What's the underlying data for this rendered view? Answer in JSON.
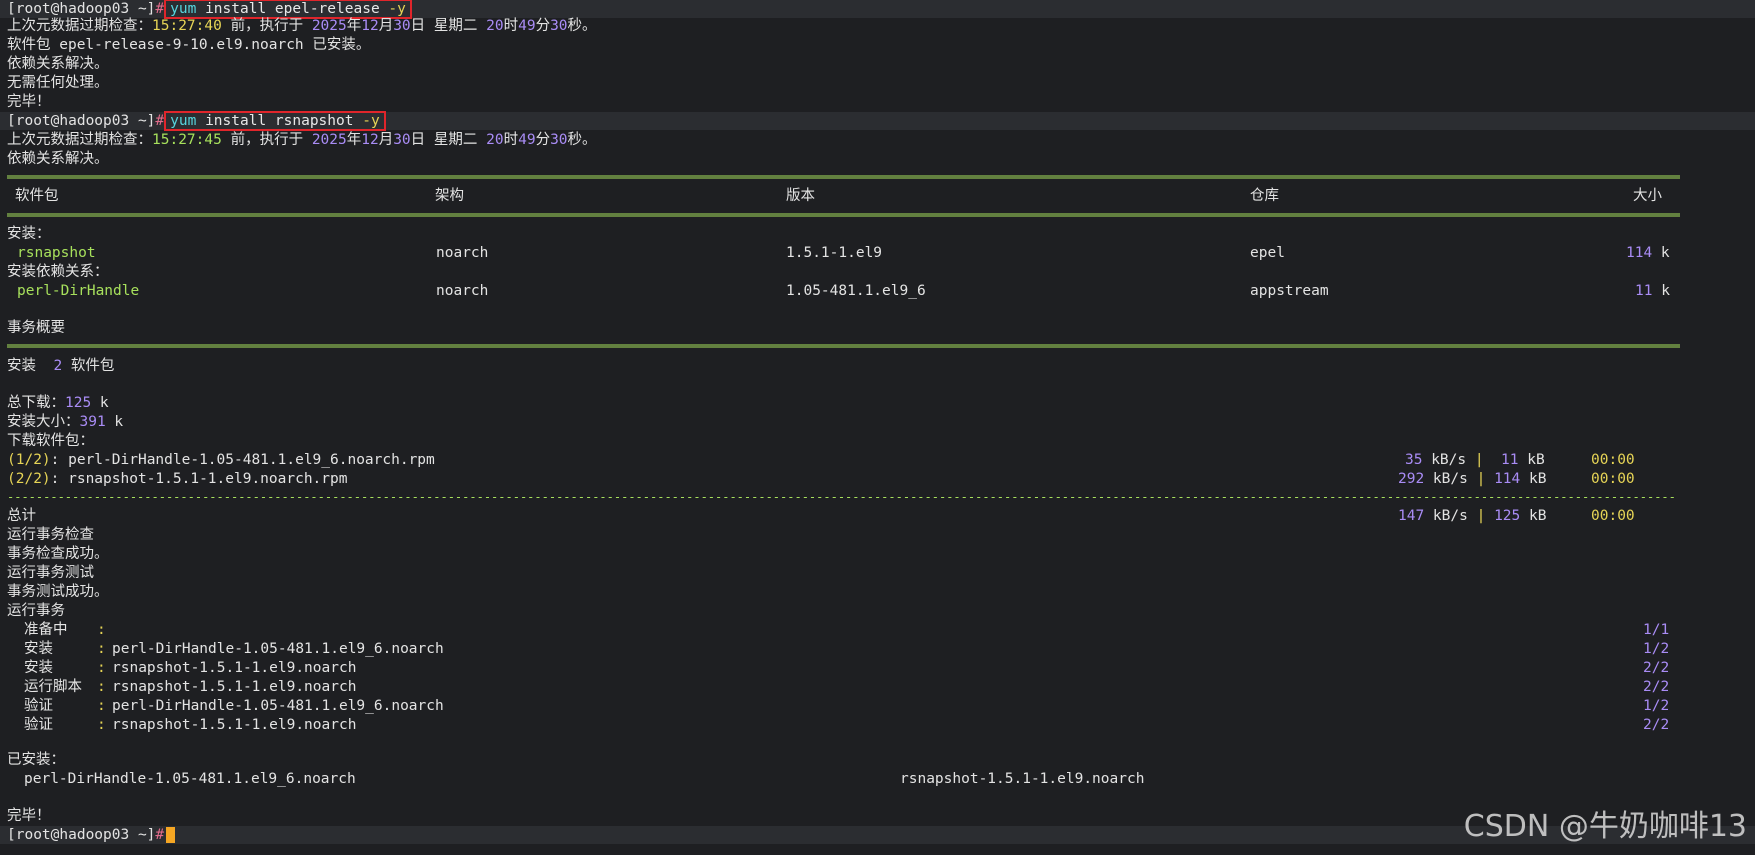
{
  "prompt": "[root@hadoop03 ~]",
  "hash": "#",
  "cmd1": {
    "yum": "yum",
    "rest": " install epel-release ",
    "flag": "-y"
  },
  "meta1": {
    "pre": "上次元数据过期检查：",
    "time": "15:27:40",
    "mid": " 前，执行于 ",
    "year": "2025",
    "nian": "年",
    "month": "12",
    "yue": "月",
    "day": "30",
    "ri": "日 星期二 ",
    "hour": "20",
    "shi": "时",
    "min": "49",
    "fen": "分",
    "sec": "30",
    "miao": "秒。"
  },
  "pkg_installed": "软件包 epel-release-9-10.el9.noarch 已安装。",
  "deps_resolved": "依赖关系解决。",
  "nothing_to_do": "无需任何处理。",
  "done1": "完毕！",
  "cmd2": {
    "yum": "yum",
    "rest": " install rsnapshot ",
    "flag": "-y"
  },
  "meta2": {
    "pre": "上次元数据过期检查：",
    "time": "15:27:45",
    "mid": " 前，执行于 ",
    "year": "2025",
    "nian": "年",
    "month": "12",
    "yue": "月",
    "day": "30",
    "ri": "日 星期二 ",
    "hour": "20",
    "shi": "时",
    "min": "49",
    "fen": "分",
    "sec": "30",
    "miao": "秒。"
  },
  "deps_resolved2": "依赖关系解决。",
  "table": {
    "headers": {
      "pkg": "软件包",
      "arch": "架构",
      "ver": "版本",
      "repo": "仓库",
      "size": "大小"
    },
    "install_label": "安装：",
    "dep_label": "安装依赖关系：",
    "rows": [
      {
        "name": "rsnapshot",
        "arch": "noarch",
        "ver": "1.5.1-1.el9",
        "repo": "epel",
        "size": "114",
        "unit": " k"
      },
      {
        "name": "perl-DirHandle",
        "arch": "noarch",
        "ver": "1.05-481.1.el9_6",
        "repo": "appstream",
        "size": "11",
        "unit": " k"
      }
    ]
  },
  "summary": {
    "title": "事务概要",
    "install_pre": "安装  ",
    "install_count": "2",
    "install_post": " 软件包",
    "total_dl_label": "总下载：",
    "total_dl_val": "125",
    "total_dl_unit": " k",
    "inst_size_label": "安装大小：",
    "inst_size_val": "391",
    "inst_size_unit": " k",
    "downloading": "下载软件包："
  },
  "downloads": [
    {
      "idx": "(1/2)",
      "sep": ":",
      "file": " perl-DirHandle-1.05-481.1.el9_6.noarch.rpm",
      "speed": "35",
      "speed_unit": " kB/s",
      "bar": " | ",
      "size": " 11",
      "size_unit": " kB",
      "time": "00:00"
    },
    {
      "idx": "(2/2)",
      "sep": ":",
      "file": " rsnapshot-1.5.1-1.el9.noarch.rpm",
      "speed": "292",
      "speed_unit": " kB/s",
      "bar": " | ",
      "size": "114",
      "size_unit": " kB",
      "time": "00:00"
    }
  ],
  "total": {
    "label": "总计",
    "speed": "147",
    "speed_unit": " kB/s",
    "bar": " | ",
    "size": "125",
    "size_unit": " kB",
    "time": "00:00"
  },
  "transaction": [
    "运行事务检查",
    "事务检查成功。",
    "运行事务测试",
    "事务测试成功。",
    "运行事务"
  ],
  "steps": [
    {
      "label": "准备中",
      "colon": ":",
      "pkg": "",
      "count": "1/1"
    },
    {
      "label": "安装",
      "colon": ":",
      "pkg": "perl-DirHandle-1.05-481.1.el9_6.noarch",
      "count": "1/2"
    },
    {
      "label": "安装",
      "colon": ":",
      "pkg": "rsnapshot-1.5.1-1.el9.noarch",
      "count": "2/2"
    },
    {
      "label": "运行脚本",
      "colon": ":",
      "pkg": "rsnapshot-1.5.1-1.el9.noarch",
      "count": "2/2"
    },
    {
      "label": "验证",
      "colon": ":",
      "pkg": "perl-DirHandle-1.05-481.1.el9_6.noarch",
      "count": "1/2"
    },
    {
      "label": "验证",
      "colon": ":",
      "pkg": "rsnapshot-1.5.1-1.el9.noarch",
      "count": "2/2"
    }
  ],
  "installed_label": "已安装：",
  "installed": [
    "perl-DirHandle-1.05-481.1.el9_6.noarch",
    "rsnapshot-1.5.1-1.el9.noarch"
  ],
  "done2": "完毕！",
  "watermark": "CSDN @牛奶咖啡13",
  "colors": {
    "background": "#1e1f22",
    "prompt_bar": "#2b2d31",
    "highlight_box": "#e0252b",
    "cursor": "#f5a623"
  }
}
